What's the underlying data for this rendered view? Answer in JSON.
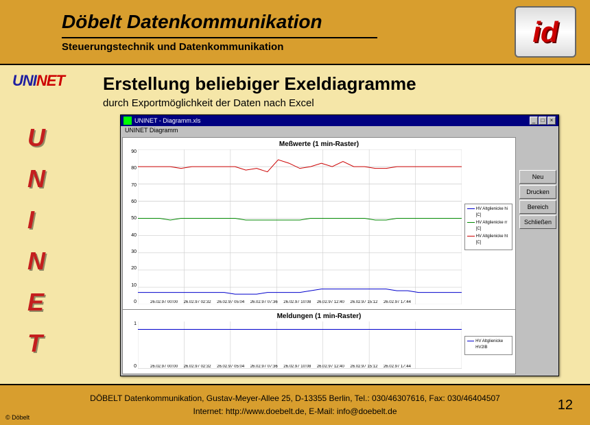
{
  "header": {
    "title": "Döbelt Datenkommunikation",
    "subtitle": "Steuerungstechnik und Datenkommunikation",
    "logo_text": "id"
  },
  "brand": {
    "uninet_u": "UNI",
    "uninet_n": "NET",
    "vertical": [
      "U",
      "N",
      "I",
      "N",
      "E",
      "T"
    ]
  },
  "content": {
    "title": "Erstellung beliebiger Exeldiagramme",
    "subtitle": "durch Exportmöglichkeit der Daten nach Excel"
  },
  "excel": {
    "title": "UNINET - Diagramm.xls",
    "menu": "UNINET Diagramm",
    "side_buttons": [
      "Neu",
      "Drucken",
      "Bereich",
      "Schließen"
    ]
  },
  "footer": {
    "copyright": "© Döbelt",
    "line1": "DÖBELT Datenkommunikation, Gustav-Meyer-Allee 25, D-13355 Berlin, Tel.: 030/46307616, Fax: 030/46404507",
    "line2": "Internet: http://www.doebelt.de, E-Mail: info@doebelt.de",
    "page": "12"
  },
  "chart_data": [
    {
      "type": "line",
      "title": "Meßwerte (1 min-Raster)",
      "ylim": [
        0,
        90
      ],
      "yticks": [
        0,
        10,
        20,
        30,
        40,
        50,
        60,
        70,
        80,
        90
      ],
      "x_labels": [
        "26.02.97 00:00",
        "26.02.97 02:32",
        "26.02.97 05:04",
        "26.02.97 07:36",
        "26.02.97 10:08",
        "26.02.97 12:40",
        "26.02.97 15:12",
        "26.02.97 17:44"
      ],
      "series": [
        {
          "name": "HV Altglienicke hi [C]",
          "color": "#0000cc",
          "values": [
            7,
            7,
            7,
            7,
            7,
            7,
            7,
            7,
            7,
            6,
            6,
            6,
            7,
            7,
            7,
            7,
            8,
            9,
            9,
            9,
            9,
            9,
            9,
            9,
            8,
            8,
            7,
            7,
            7,
            7,
            7
          ]
        },
        {
          "name": "HV Altglienicke rr [C]",
          "color": "#008800",
          "values": [
            50,
            50,
            50,
            49,
            50,
            50,
            50,
            50,
            50,
            50,
            49,
            49,
            49,
            49,
            49,
            49,
            50,
            50,
            50,
            50,
            50,
            50,
            49,
            49,
            50,
            50,
            50,
            50,
            50,
            50,
            50
          ]
        },
        {
          "name": "HV Altglienicke ht [C]",
          "color": "#cc0000",
          "values": [
            80,
            80,
            80,
            80,
            79,
            80,
            80,
            80,
            80,
            80,
            78,
            79,
            77,
            84,
            82,
            79,
            80,
            82,
            80,
            83,
            80,
            80,
            79,
            79,
            80,
            80,
            80,
            80,
            80,
            80,
            80
          ]
        }
      ]
    },
    {
      "type": "line",
      "title": "Meldungen (1 min-Raster)",
      "ylim": [
        0,
        1.2
      ],
      "yticks": [
        0,
        1
      ],
      "x_labels": [
        "26.02.97 00:00",
        "26.02.97 02:32",
        "26.02.97 05:04",
        "26.02.97 07:36",
        "26.02.97 10:08",
        "26.02.97 12:40",
        "26.02.97 15:12",
        "26.02.97 17:44"
      ],
      "series": [
        {
          "name": "HV Altglienicke HV2IB",
          "color": "#0000cc",
          "values": [
            1,
            1,
            1,
            1,
            1,
            1,
            1,
            1,
            1,
            1,
            1,
            1,
            1,
            1,
            1,
            1,
            1,
            1,
            1,
            1,
            1,
            1,
            1,
            1,
            1,
            1,
            1,
            1,
            1,
            1,
            1
          ]
        }
      ]
    }
  ]
}
